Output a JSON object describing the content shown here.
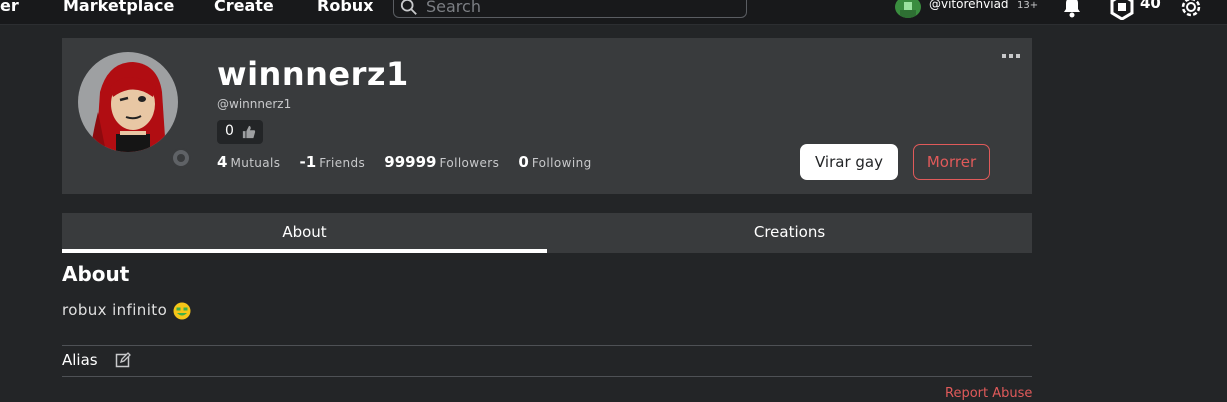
{
  "nav": {
    "items": [
      "er",
      "Marketplace",
      "Create",
      "Robux"
    ],
    "search_placeholder": "Search"
  },
  "account": {
    "username": "@vitorehviad",
    "age_label": "13+",
    "robux": "40"
  },
  "profile": {
    "display_name": "winnnerz1",
    "handle": "@winnnerz1",
    "badge_count": "0",
    "stats": [
      {
        "value": "4",
        "label": "Mutuals"
      },
      {
        "value": "-1",
        "label": "Friends"
      },
      {
        "value": "99999",
        "label": "Followers"
      },
      {
        "value": "0",
        "label": "Following"
      }
    ],
    "primary_button": "Virar gay",
    "secondary_button": "Morrer"
  },
  "tabs": [
    "About",
    "Creations"
  ],
  "about": {
    "title": "About",
    "text": "robux infinito",
    "emoji": "money-mouth-face-icon",
    "alias_label": "Alias",
    "report": "Report Abuse"
  },
  "colors": {
    "page_bg": "#232527",
    "card_bg": "#393b3d",
    "danger": "#e05a5a"
  }
}
